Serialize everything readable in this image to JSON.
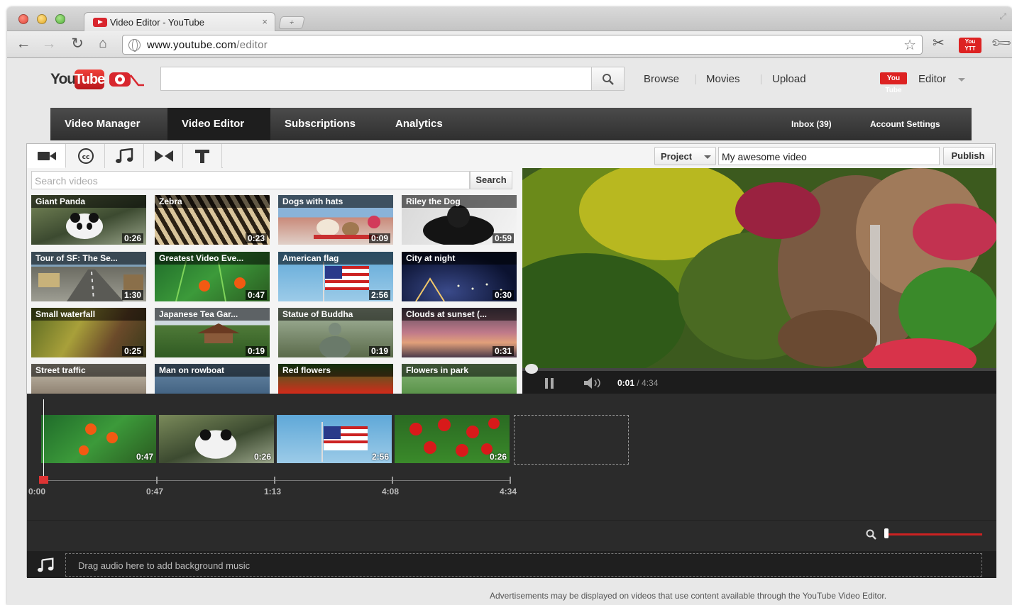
{
  "browser": {
    "tab_title": "Video Editor - YouTube",
    "tab_close": "×",
    "newtab_glyph": "+",
    "url_host": "www.youtube.com",
    "url_path": "/editor",
    "ext_badge_line1": "You",
    "ext_badge_line2": "YTT"
  },
  "header": {
    "logo_you": "You",
    "logo_tube": "Tube",
    "links": [
      "Browse",
      "Movies",
      "Upload"
    ],
    "mini_logo": "You Tube",
    "editor_label": "Editor"
  },
  "nav": {
    "items": [
      "Video Manager",
      "Video Editor",
      "Subscriptions",
      "Analytics"
    ],
    "inbox": "Inbox (39)",
    "account": "Account Settings"
  },
  "editor": {
    "project_label": "Project",
    "project_name": "My awesome video",
    "publish_label": "Publish",
    "search_placeholder": "Search videos",
    "search_button": "Search"
  },
  "videos": [
    {
      "title": "Giant Panda",
      "duration": "0:26"
    },
    {
      "title": "Zebra",
      "duration": "0:23"
    },
    {
      "title": "Dogs with hats",
      "duration": "0:09"
    },
    {
      "title": "Riley the Dog",
      "duration": "0:59"
    },
    {
      "title": "Tour of SF: The Se...",
      "duration": "1:30"
    },
    {
      "title": "Greatest Video Eve...",
      "duration": "0:47"
    },
    {
      "title": "American flag",
      "duration": "2:56"
    },
    {
      "title": "City at night",
      "duration": "0:30"
    },
    {
      "title": "Small waterfall",
      "duration": "0:25"
    },
    {
      "title": "Japanese Tea Gar...",
      "duration": "0:19"
    },
    {
      "title": "Statue of Buddha",
      "duration": "0:19"
    },
    {
      "title": "Clouds at sunset (...",
      "duration": "0:31"
    },
    {
      "title": "Street traffic",
      "duration": ""
    },
    {
      "title": "Man on rowboat",
      "duration": ""
    },
    {
      "title": "Red flowers",
      "duration": ""
    },
    {
      "title": "Flowers in park",
      "duration": ""
    }
  ],
  "player": {
    "current_time": "0:01",
    "total_time": "/ 4:34"
  },
  "timeline": {
    "clips": [
      {
        "duration": "0:47"
      },
      {
        "duration": "0:26"
      },
      {
        "duration": "2:56"
      },
      {
        "duration": "0:26"
      }
    ],
    "ticks": [
      "0:00",
      "0:47",
      "1:13",
      "4:08",
      "4:34"
    ],
    "audio_hint": "Drag audio here to add background music"
  },
  "footnote": "Advertisements may be displayed on videos that use content available through the YouTube Video Editor.",
  "colors": {
    "brand_red": "#d8262e",
    "nav_bg": "#3a3a3a",
    "timeline_bg": "#2b2b2b"
  }
}
